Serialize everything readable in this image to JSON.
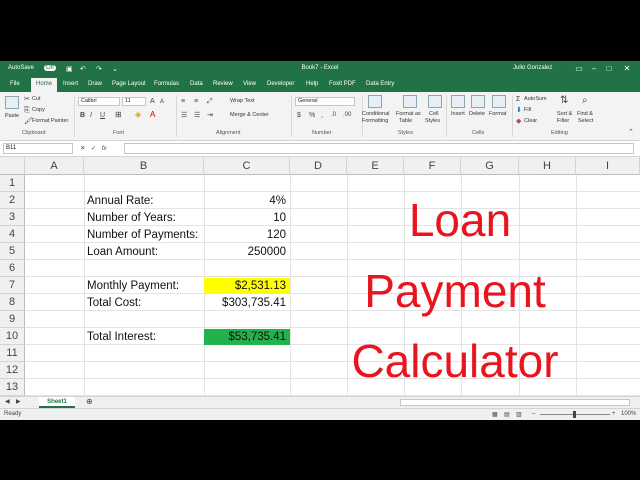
{
  "window": {
    "autosave_label": "AutoSave",
    "autosave_state": "Off",
    "title": "Book7 - Excel",
    "user": "Julio Gonzalez"
  },
  "menu": {
    "tabs": [
      "File",
      "Home",
      "Insert",
      "Draw",
      "Page Layout",
      "Formulas",
      "Data",
      "Review",
      "View",
      "Developer",
      "Help",
      "Foxit PDF",
      "Data Entry"
    ],
    "active": "Home"
  },
  "ribbon": {
    "clipboard": {
      "cut": "Cut",
      "copy": "Copy",
      "format_painter": "Format Painter",
      "paste": "Paste",
      "label": "Clipboard"
    },
    "font": {
      "name": "Calibri",
      "size": "11",
      "label": "Font"
    },
    "alignment": {
      "wrap": "Wrap Text",
      "merge": "Merge & Center",
      "label": "Alignment"
    },
    "number": {
      "format": "General",
      "label": "Number"
    },
    "styles": {
      "conditional": "Conditional",
      "formatting": "Formatting",
      "format_as": "Format as",
      "table": "Table",
      "cell": "Cell",
      "cell_styles": "Styles",
      "label": "Styles"
    },
    "cells": {
      "insert": "Insert",
      "delete": "Delete",
      "format": "Format",
      "label": "Cells"
    },
    "editing": {
      "autosum": "AutoSum",
      "fill": "Fill",
      "clear": "Clear",
      "sort": "Sort &",
      "filter": "Filter",
      "find": "Find &",
      "select": "Select",
      "label": "Editing"
    }
  },
  "formula_bar": {
    "name_box": "B11",
    "fx": "fx"
  },
  "grid": {
    "columns": [
      "A",
      "B",
      "C",
      "D",
      "E",
      "F",
      "G",
      "H",
      "I"
    ],
    "rows": [
      "1",
      "2",
      "3",
      "4",
      "5",
      "6",
      "7",
      "8",
      "9",
      "10",
      "11",
      "12",
      "13"
    ]
  },
  "cells": {
    "annual_rate_label": "Annual Rate:",
    "annual_rate": "4%",
    "years_label": "Number of Years:",
    "years": "10",
    "payments_label": "Number of Payments:",
    "payments": "120",
    "loan_label": "Loan Amount:",
    "loan": "250000",
    "monthly_label": "Monthly Payment:",
    "monthly": "$2,531.13",
    "total_cost_label": "Total Cost:",
    "total_cost": "$303,735.41",
    "interest_label": "Total Interest:",
    "interest": "$53,735.41"
  },
  "overlay": {
    "line1": "Loan",
    "line2": "Payment",
    "line3": "Calculator"
  },
  "sheet": {
    "tab": "Sheet1"
  },
  "status": {
    "ready": "Ready",
    "zoom": "100%"
  },
  "colors": {
    "excel_green": "#217346",
    "title_red": "#e8141e",
    "highlight_yellow": "#ffff00",
    "highlight_green": "#22b14c"
  }
}
